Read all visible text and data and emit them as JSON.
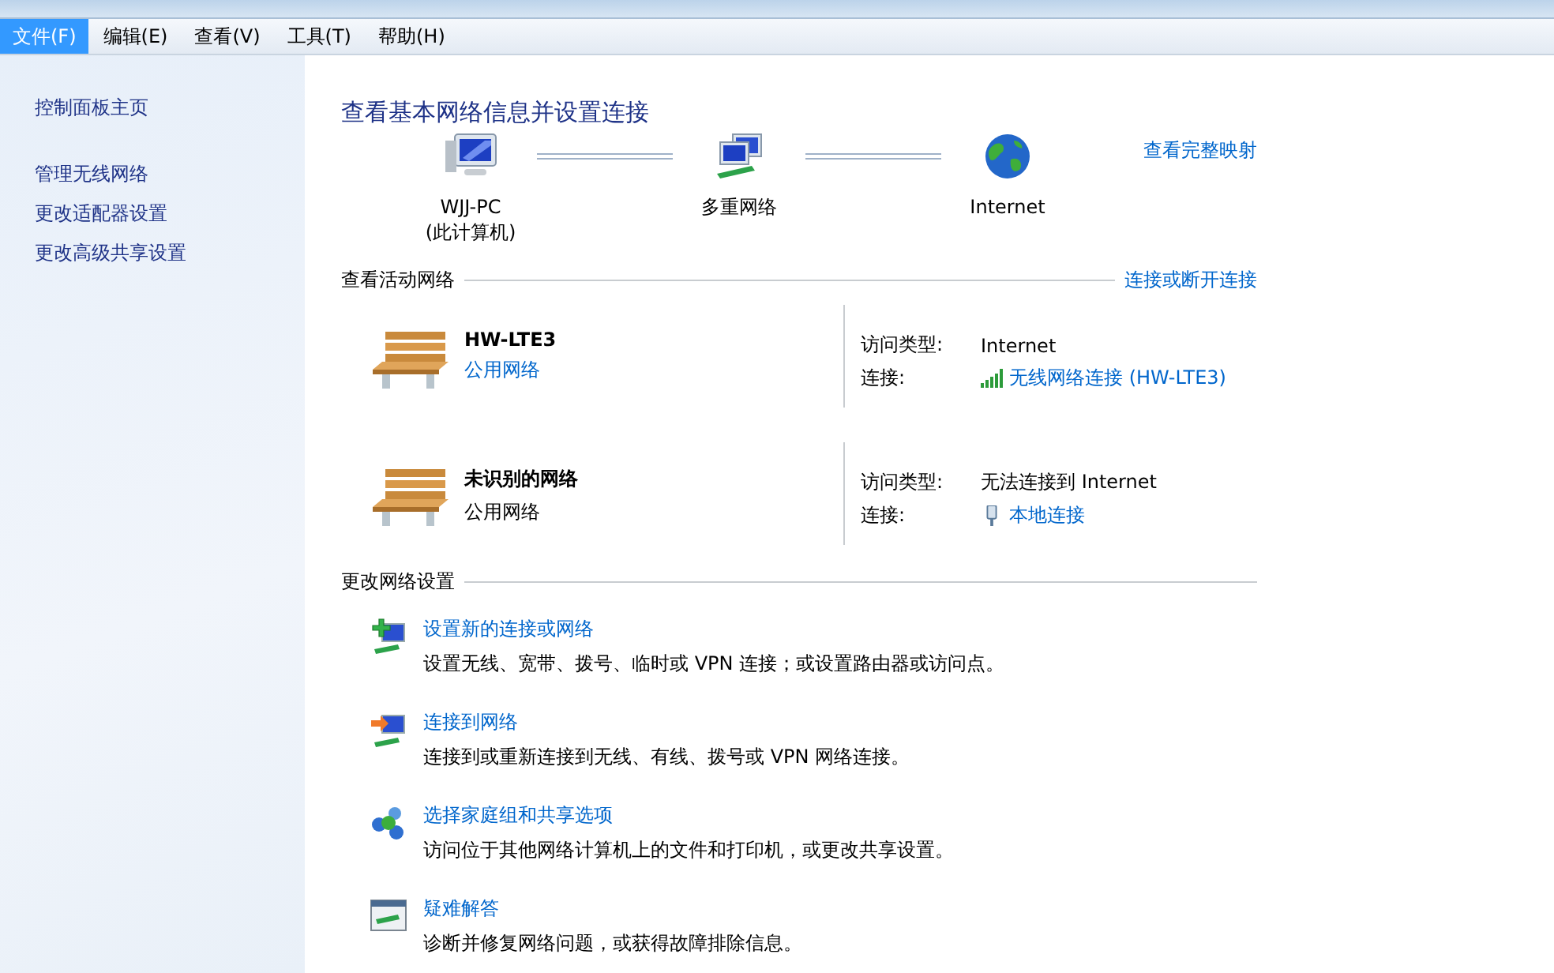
{
  "menu": [
    {
      "label": "文件(F)",
      "selected": true
    },
    {
      "label": "编辑(E)",
      "selected": false
    },
    {
      "label": "查看(V)",
      "selected": false
    },
    {
      "label": "工具(T)",
      "selected": false
    },
    {
      "label": "帮助(H)",
      "selected": false
    }
  ],
  "sidebar": {
    "items": [
      {
        "label": "控制面板主页"
      },
      {
        "label": "管理无线网络"
      },
      {
        "label": "更改适配器设置"
      },
      {
        "label": "更改高级共享设置"
      }
    ]
  },
  "title": "查看基本网络信息并设置连接",
  "map": {
    "nodes": [
      {
        "kind": "computer",
        "label": "WJJ-PC",
        "sublabel": "(此计算机)"
      },
      {
        "kind": "network",
        "label": "多重网络"
      },
      {
        "kind": "globe",
        "label": "Internet"
      }
    ],
    "link": "查看完整映射"
  },
  "active": {
    "heading": "查看活动网络",
    "link": "连接或断开连接",
    "networks": [
      {
        "name": "HW-LTE3",
        "type": "公用网络",
        "type_is_link": true,
        "access_label": "访问类型:",
        "access": "Internet",
        "connection_label": "连接:",
        "connection": {
          "kind": "wireless",
          "label": "无线网络连接 (HW-LTE3)"
        }
      },
      {
        "name": "未识别的网络",
        "type": "公用网络",
        "type_is_link": false,
        "access_label": "访问类型:",
        "access": "无法连接到 Internet",
        "connection_label": "连接:",
        "connection": {
          "kind": "wired",
          "label": "本地连接"
        }
      }
    ]
  },
  "settings": {
    "heading": "更改网络设置",
    "tasks": [
      {
        "kind": "new",
        "title": "设置新的连接或网络",
        "description": "设置无线、宽带、拨号、临时或 VPN 连接；或设置路由器或访问点。"
      },
      {
        "kind": "connect",
        "title": "连接到网络",
        "description": "连接到或重新连接到无线、有线、拨号或 VPN 网络连接。"
      },
      {
        "kind": "homegroup",
        "title": "选择家庭组和共享选项",
        "description": "访问位于其他网络计算机上的文件和打印机，或更改共享设置。"
      },
      {
        "kind": "troubleshoot",
        "title": "疑难解答",
        "description": "诊断并修复网络问题，或获得故障排除信息。"
      }
    ]
  }
}
